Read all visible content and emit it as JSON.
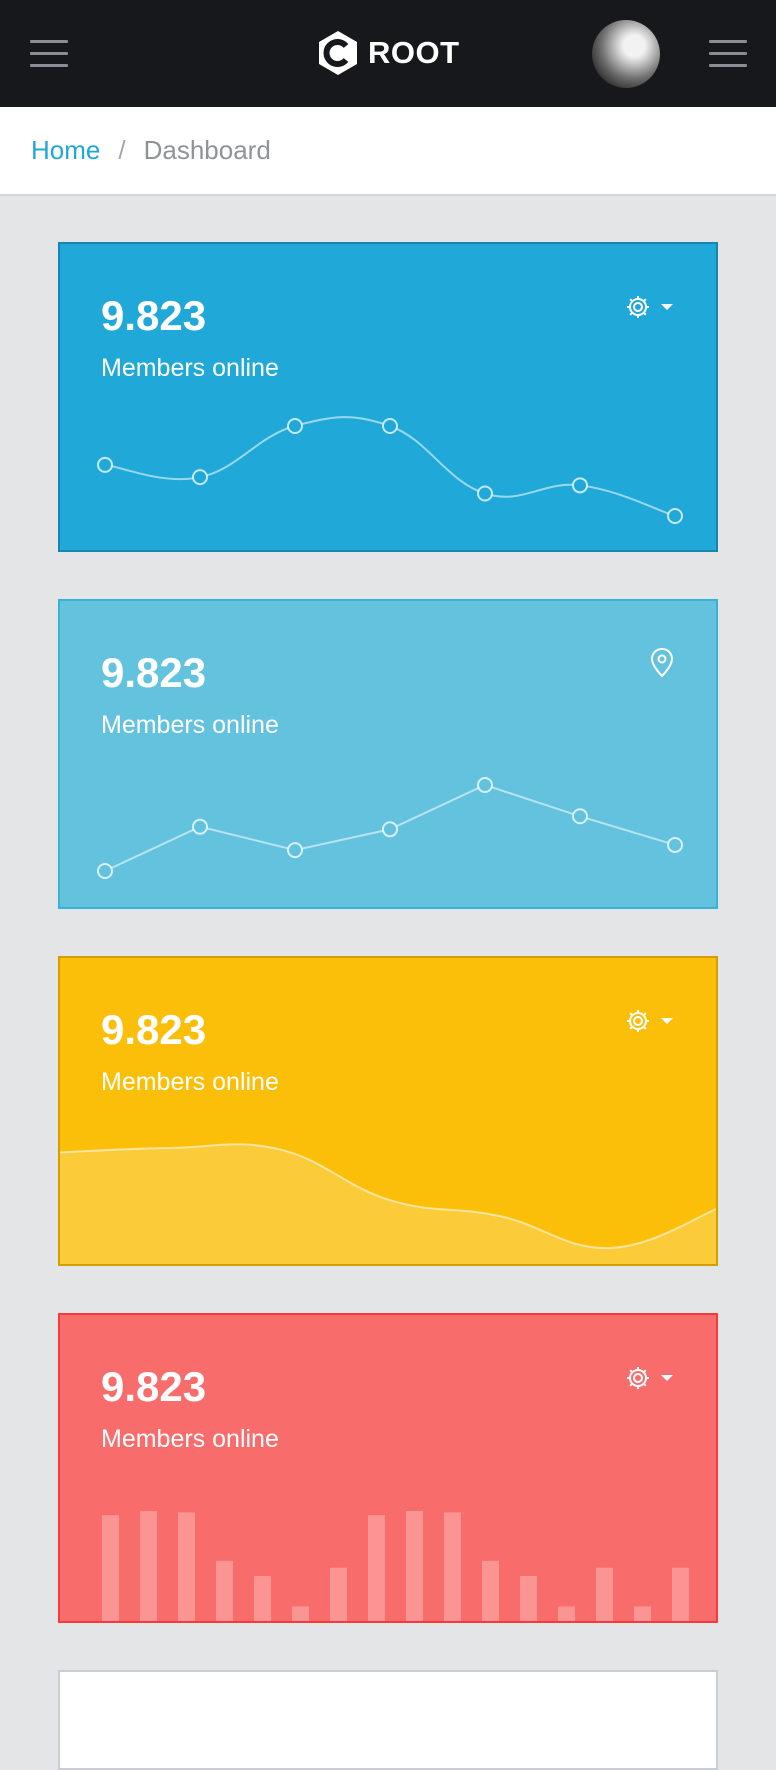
{
  "header": {
    "brand": "ROOT",
    "menu_icon": "hamburger-icon",
    "aside_icon": "hamburger-icon",
    "avatar_icon": "avatar"
  },
  "breadcrumb": {
    "items": [
      "Home",
      "Dashboard"
    ],
    "separator": "/"
  },
  "colors": {
    "primary": "#20a8d8",
    "info": "#63c2de",
    "warning": "#fcbf09",
    "danger": "#f86c6b",
    "topbar": "#17181c",
    "background": "#e4e5e6"
  },
  "cards": [
    {
      "value": "9.823",
      "label": "Members online",
      "tool_icon": "gear-icon",
      "caret_icon": "caret-down-icon",
      "chart_type": "line-smooth"
    },
    {
      "value": "9.823",
      "label": "Members online",
      "tool_icon": "location-pin-icon",
      "chart_type": "line"
    },
    {
      "value": "9.823",
      "label": "Members online",
      "tool_icon": "gear-icon",
      "caret_icon": "caret-down-icon",
      "chart_type": "area"
    },
    {
      "value": "9.823",
      "label": "Members online",
      "tool_icon": "gear-icon",
      "caret_icon": "caret-down-icon",
      "chart_type": "bar"
    }
  ],
  "chart_data": [
    {
      "type": "line",
      "values": [
        65,
        59,
        84,
        84,
        51,
        55,
        40
      ]
    },
    {
      "type": "line",
      "values": [
        1,
        18,
        9,
        17,
        34,
        22,
        11
      ]
    },
    {
      "type": "area",
      "values": [
        78,
        81,
        80,
        45,
        34,
        12,
        40
      ]
    },
    {
      "type": "bar",
      "values": [
        78,
        81,
        80,
        45,
        34,
        12,
        40,
        78,
        81,
        80,
        45,
        34,
        12,
        40,
        12,
        40
      ]
    }
  ]
}
